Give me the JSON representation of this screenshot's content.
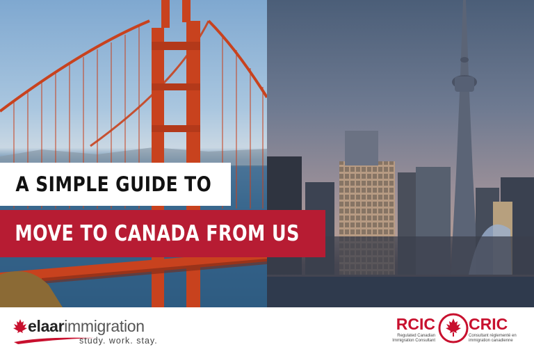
{
  "headline": {
    "line1": "A SIMPLE GUIDE TO",
    "line2": "MOVE TO CANADA FROM US"
  },
  "brand": {
    "name_bold": "elaar",
    "name_regular": "immigration",
    "tagline": "study. work. stay."
  },
  "badge": {
    "left_code": "RCIC",
    "left_sub": "Regulated Canadian Immigration Consultant",
    "right_code": "CRIC",
    "right_sub": "Consultant réglementé en immigration canadienne"
  },
  "images": {
    "left": "golden-gate-bridge-photo",
    "right": "toronto-skyline-cn-tower-photo"
  },
  "colors": {
    "accent_red": "#b71c33",
    "bridge_orange": "#c8421e",
    "headline_dark": "#111111"
  }
}
